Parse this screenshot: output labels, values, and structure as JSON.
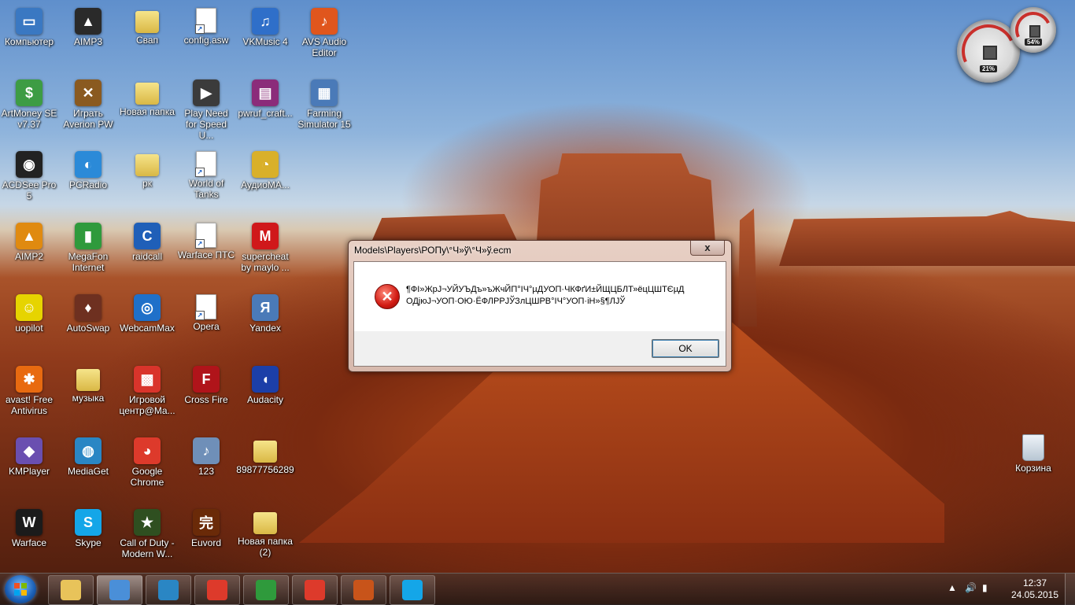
{
  "desktop": {
    "icons": [
      {
        "label": "Компьютер",
        "glyph": "▭",
        "color": "#3a78c2"
      },
      {
        "label": "AIMP3",
        "glyph": "▲",
        "color": "#2a2a2a"
      },
      {
        "label": "Свап",
        "type": "folder"
      },
      {
        "label": "config.asw",
        "type": "doc"
      },
      {
        "label": "VKMusic 4",
        "glyph": "♫",
        "color": "#2f6fc9"
      },
      {
        "label": "AVS Audio\nEditor",
        "glyph": "♪",
        "color": "#e0561d"
      },
      {
        "label": "ArtMoney SE\nv7.37",
        "glyph": "$",
        "color": "#3d9c44"
      },
      {
        "label": "Играть\nAverion PW",
        "glyph": "✕",
        "color": "#8a5a20"
      },
      {
        "label": "Новая папка",
        "type": "folder"
      },
      {
        "label": "Play  Need\nfor Speed U...",
        "glyph": "▶",
        "color": "#3b3b3b"
      },
      {
        "label": "pwruf_craft...",
        "glyph": "▤",
        "color": "#8b2c7a"
      },
      {
        "label": "Farming\nSimulator 15",
        "glyph": "▦",
        "color": "#4a7ab8"
      },
      {
        "label": "ACDSee Pro\n5",
        "glyph": "◉",
        "color": "#222"
      },
      {
        "label": "PCRadio",
        "glyph": "◐",
        "color": "#2b8ad8"
      },
      {
        "label": "рк",
        "type": "folder"
      },
      {
        "label": "World of\nTanks",
        "type": "doc"
      },
      {
        "label": "АудиоМА...",
        "glyph": "◔",
        "color": "#d9b02a"
      },
      {
        "label": "AIMP2",
        "glyph": "▲",
        "color": "#e08a10"
      },
      {
        "label": "MegaFon\nInternet",
        "glyph": "▮",
        "color": "#2f9a3c"
      },
      {
        "label": "raidcall",
        "glyph": "C",
        "color": "#1f5fb8"
      },
      {
        "label": "Warface ПТС",
        "type": "doc"
      },
      {
        "label": "supercheat\nby maylo ...",
        "glyph": "M",
        "color": "#d0181a"
      },
      {
        "label": "uopilot",
        "glyph": "☺",
        "color": "#e6d400"
      },
      {
        "label": "AutoSwap",
        "glyph": "♦",
        "color": "#6e3020"
      },
      {
        "label": "WebcamMax",
        "glyph": "◎",
        "color": "#1f70c9"
      },
      {
        "label": "Opera",
        "type": "doc"
      },
      {
        "label": "Yandex",
        "glyph": "Я",
        "color": "#4a7ab8"
      },
      {
        "label": "avast! Free\nAntivirus",
        "glyph": "✱",
        "color": "#e86a10"
      },
      {
        "label": "музыка",
        "type": "folder"
      },
      {
        "label": "Игровой\nцентр@Ma...",
        "glyph": "▩",
        "color": "#d9342b"
      },
      {
        "label": "Cross Fire",
        "glyph": "F",
        "color": "#b0141a"
      },
      {
        "label": "Audacity",
        "glyph": "◖",
        "color": "#1c3fa8"
      },
      {
        "label": "KMPlayer",
        "glyph": "◆",
        "color": "#6a4fb0"
      },
      {
        "label": "MediaGet",
        "glyph": "◍",
        "color": "#2a86c4"
      },
      {
        "label": "Google\nChrome",
        "glyph": "◕",
        "color": "#dd3a2b"
      },
      {
        "label": "123",
        "glyph": "♪",
        "color": "#6f8fb8"
      },
      {
        "label": "89877756289",
        "type": "folder"
      },
      {
        "label": "Warface",
        "glyph": "W",
        "color": "#1b1b1b"
      },
      {
        "label": "Skype",
        "glyph": "S",
        "color": "#14a6e8"
      },
      {
        "label": "Call of Duty -\nModern W...",
        "glyph": "★",
        "color": "#2f4f20"
      },
      {
        "label": "Euvord",
        "glyph": "完",
        "color": "#6a2a08"
      },
      {
        "label": "Новая папка\n(2)",
        "type": "folder"
      }
    ],
    "recycle_bin": {
      "label": "Корзина"
    }
  },
  "gadgets": {
    "cpu_percent": "21%",
    "memory_percent": "54%"
  },
  "dialog": {
    "title": "Models\\Players\\РОПу\\°Ч»ў\\°Ч»ў.ecm",
    "message": "¶ФI»ЖрЈ¬УЙУЪДъ»ъЖчЙП°IЧ°µДУОП·ЧКФґИ±ЙЩЦБЛТ»ёцЦШТЄµД ОДјюЈ¬УОП·ОЮ·ЁФЛРРЈЎЗлЦШРВ°IЧ°УОП·іН»§¶ЛЈЎ",
    "ok_label": "OK",
    "close_label": "x"
  },
  "taskbar": {
    "pinned": [
      {
        "name": "explorer",
        "color": "#e8c35a"
      },
      {
        "name": "media-player",
        "color": "#4a8fd8"
      },
      {
        "name": "mediaget",
        "color": "#2a86c4"
      },
      {
        "name": "chrome",
        "color": "#dd3a2b"
      },
      {
        "name": "megafon",
        "color": "#2f9a3c"
      },
      {
        "name": "chrome-2",
        "color": "#dd3a2b"
      },
      {
        "name": "euvord",
        "color": "#c8541a"
      },
      {
        "name": "skype",
        "color": "#14a6e8"
      }
    ],
    "clock_time": "12:37",
    "clock_date": "24.05.2015"
  }
}
